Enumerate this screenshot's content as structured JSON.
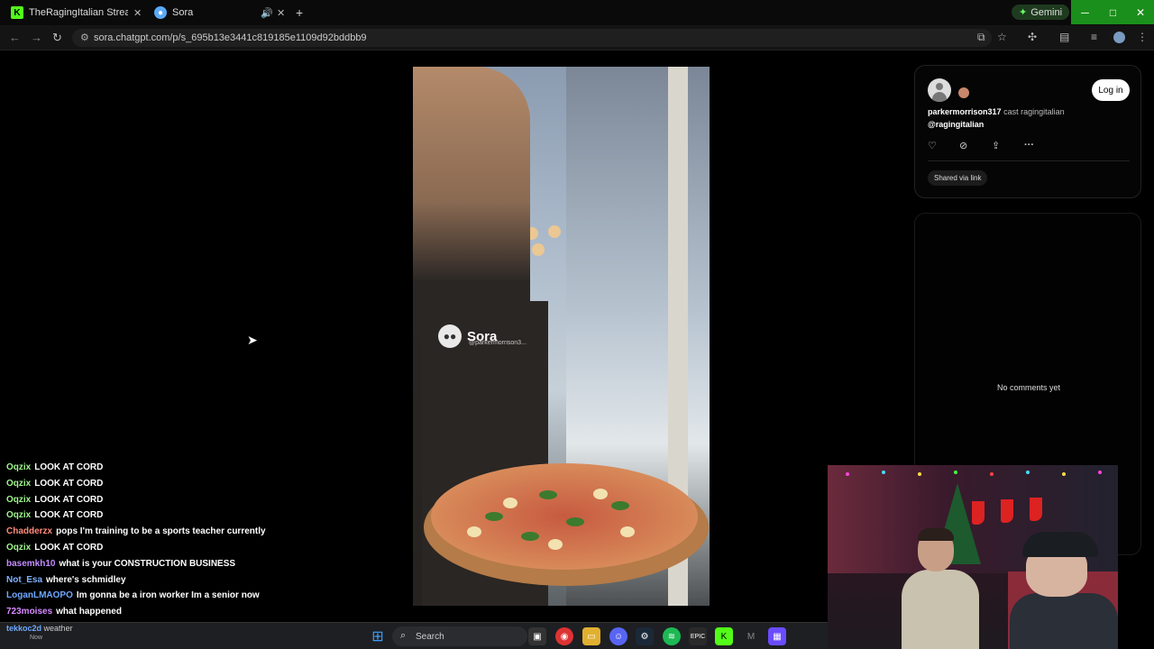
{
  "browser": {
    "tabs": [
      {
        "title": "TheRagingItalian Stream - Wat",
        "icon": "kick-favicon"
      },
      {
        "title": "Sora",
        "icon": "sora-favicon"
      }
    ],
    "new_tab_label": "+",
    "gemini_label": "Gemini",
    "url": "sora.chatgpt.com/p/s_695b13e3441c819185e1109d92bddbb9",
    "window_controls": [
      "─",
      "□",
      "✕"
    ]
  },
  "video": {
    "watermark_name": "Sora",
    "watermark_handle": "@parkermorrison3..."
  },
  "post": {
    "username": "parkermorrison317",
    "cast_text": "cast ragingitalian",
    "mention": "@ragingitalian",
    "login_label": "Log in",
    "shared_label": "Shared via link",
    "actions": [
      "heart-icon",
      "remix-icon",
      "share-icon",
      "more-icon"
    ]
  },
  "comments": {
    "empty_text": "No comments yet"
  },
  "chat": {
    "messages": [
      {
        "user": "Oqzix",
        "text": "LOOK AT CORD",
        "color": "#9ff58f"
      },
      {
        "user": "Oqzix",
        "text": "LOOK AT CORD",
        "color": "#9ff58f"
      },
      {
        "user": "Oqzix",
        "text": "LOOK AT CORD",
        "color": "#9ff58f"
      },
      {
        "user": "Oqzix",
        "text": "LOOK AT CORD",
        "color": "#9ff58f"
      },
      {
        "user": "Chadderzx",
        "text": "pops I'm training to be a sports teacher currently",
        "color": "#ff8a7a"
      },
      {
        "user": "Oqzix",
        "text": "LOOK AT CORD",
        "color": "#9ff58f"
      },
      {
        "user": "basemkh10",
        "text": "what is your CONSTRUCTION BUSINESS",
        "color": "#c58cff"
      },
      {
        "user": "Not_Esa",
        "text": "where's schmidley",
        "color": "#7fb3ff"
      },
      {
        "user": "LoganLMAOPO",
        "text": "Im gonna be a iron worker Im a senior now",
        "color": "#6fa8ff"
      },
      {
        "user": "723moises",
        "text": "what happened",
        "color": "#d88bff"
      }
    ],
    "notification": {
      "user": "tekkoc2d",
      "text": "weather",
      "time": "Now"
    }
  },
  "taskbar": {
    "search_placeholder": "Search"
  },
  "colors": {
    "win_green": "#1b8f1b",
    "accent": "#19c519"
  }
}
